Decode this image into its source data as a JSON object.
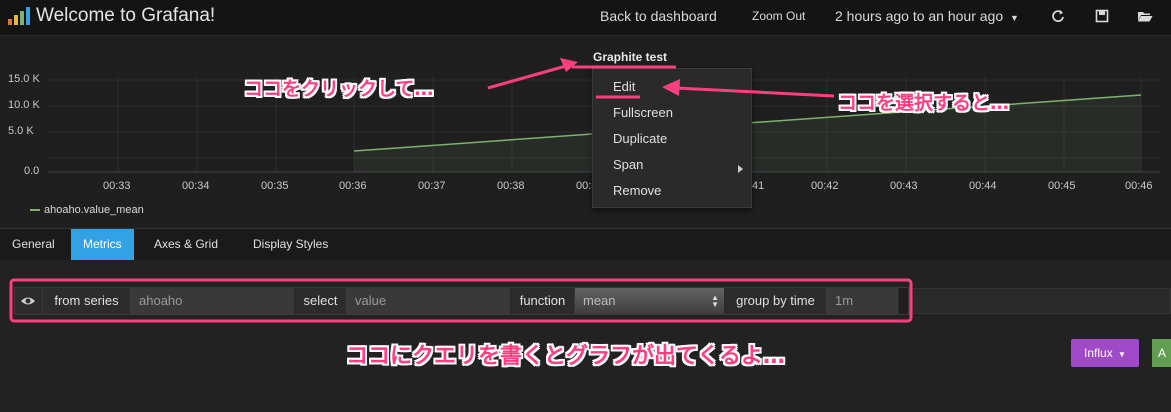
{
  "header": {
    "title": "Welcome to Grafana!",
    "back_link": "Back to dashboard",
    "zoom_out": "Zoom Out",
    "time_range": "2 hours ago to an hour ago",
    "icons": [
      "refresh-icon",
      "save-icon",
      "folder-open-icon"
    ]
  },
  "panel": {
    "title": "Graphite test",
    "y_ticks": [
      "15.0 K",
      "10.0 K",
      "5.0 K",
      "0.0"
    ],
    "x_ticks": [
      "00:33",
      "00:34",
      "00:35",
      "00:36",
      "00:37",
      "00:38",
      "00:3",
      "41",
      "00:42",
      "00:43",
      "00:44",
      "00:45",
      "00:46"
    ],
    "legend": "ahoaho.value_mean",
    "series_color": "#7eb26d"
  },
  "context_menu": {
    "items": [
      "Edit",
      "Fullscreen",
      "Duplicate",
      "Span",
      "Remove"
    ]
  },
  "tabs": [
    "General",
    "Metrics",
    "Axes & Grid",
    "Display Styles"
  ],
  "active_tab": "Metrics",
  "query": {
    "from_label": "from series",
    "from_value": "ahoaho",
    "select_label": "select",
    "select_value": "value",
    "function_label": "function",
    "function_value": "mean",
    "group_label": "group by time",
    "group_value": "1m"
  },
  "buttons": {
    "influx": "Influx",
    "add": "A"
  },
  "annotations": {
    "click_here": "ココをクリックして…",
    "select_here": "ココを選択すると…",
    "query_here": "ココにクエリを書くとグラフが出てくるよ…"
  },
  "colors": {
    "accent": "#33a2e5",
    "annotation": "#ff3e7f",
    "influx": "#9f4bc9",
    "add": "#629e51"
  }
}
